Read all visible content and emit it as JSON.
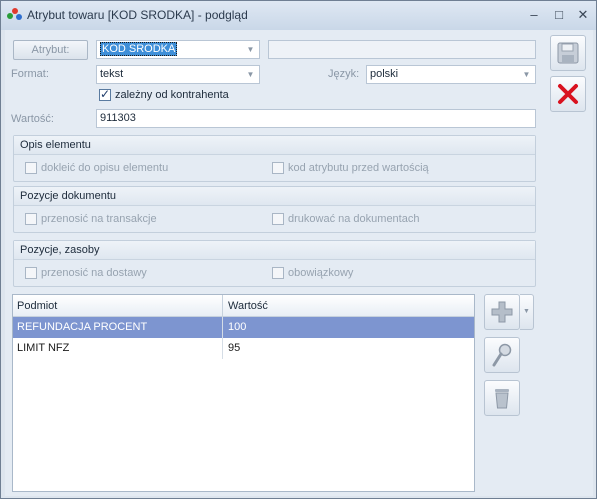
{
  "window": {
    "title": "Atrybut towaru [KOD SRODKA] - podgląd",
    "controls": {
      "minimize": "–",
      "maximize": "□",
      "close": "✕"
    }
  },
  "form": {
    "attribute_button": "Atrybut:",
    "attribute_code": "KOD SRODKA",
    "attribute_name": "",
    "format_label": "Format:",
    "format_value": "tekst",
    "language_label": "Język:",
    "language_value": "polski",
    "contractor_checkbox": {
      "label": "zależny od kontrahenta",
      "checked": true
    },
    "value_label": "Wartość:",
    "value": "911303"
  },
  "groups": {
    "opis": {
      "title": "Opis elementu",
      "option1": "dokleić do opisu elementu",
      "option2": "kod atrybutu przed wartością"
    },
    "dokument": {
      "title": "Pozycje dokumentu",
      "option1": "przenosić na transakcje",
      "option2": "drukować na dokumentach"
    },
    "zasoby": {
      "title": "Pozycje, zasoby",
      "option1": "przenosić na dostawy",
      "option2": "obowiązkowy"
    }
  },
  "grid": {
    "columns": [
      "Podmiot",
      "Wartość"
    ],
    "rows": [
      {
        "podmiot": "REFUNDACJA PROCENT",
        "wartosc": "100",
        "selected": true
      },
      {
        "podmiot": "LIMIT NFZ",
        "wartosc": "95",
        "selected": false
      }
    ]
  },
  "icons": {
    "save": "save-floppy-icon",
    "cancel": "cancel-x-icon",
    "add": "plus-icon",
    "edit": "magnifier-icon",
    "delete": "trash-icon"
  },
  "colors": {
    "cancel_red": "#d9121f",
    "selection": "#7d95d0"
  }
}
